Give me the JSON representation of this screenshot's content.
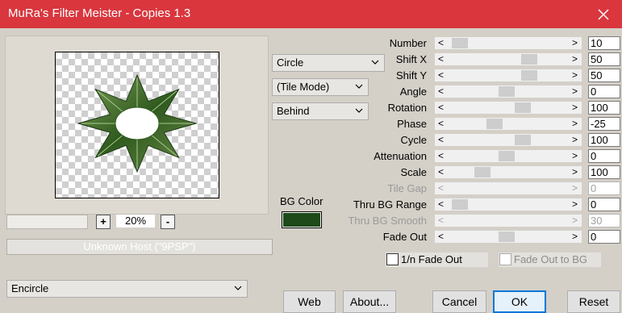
{
  "window": {
    "title": "MuRa's Filter Meister - Copies 1.3"
  },
  "preview": {
    "zoom": "20%",
    "zoom_in_label": "+",
    "zoom_out_label": "-",
    "host_text": "Unknown Host (\"9PSP\")"
  },
  "dropdowns": {
    "shape": "Circle",
    "tile_mode": "(Tile Mode)",
    "placement": "Behind",
    "preset": "Encircle"
  },
  "bg_color": {
    "label": "BG Color",
    "value": "#1e4a1a"
  },
  "params": [
    {
      "label": "Number",
      "value": "10"
    },
    {
      "label": "Shift X",
      "value": "50"
    },
    {
      "label": "Shift Y",
      "value": "50"
    },
    {
      "label": "Angle",
      "value": "0"
    },
    {
      "label": "Rotation",
      "value": "100"
    },
    {
      "label": "Phase",
      "value": "-25"
    },
    {
      "label": "Cycle",
      "value": "100"
    },
    {
      "label": "Attenuation",
      "value": "0"
    },
    {
      "label": "Scale",
      "value": "100"
    },
    {
      "label": "Tile Gap",
      "value": "0"
    },
    {
      "label": "Thru BG Range",
      "value": "0"
    },
    {
      "label": "Thru BG Smooth",
      "value": "30"
    },
    {
      "label": "Fade Out",
      "value": "0"
    }
  ],
  "checkboxes": {
    "inv_fade_out": "1/n Fade Out",
    "fade_out_bg": "Fade Out to BG"
  },
  "buttons": {
    "web": "Web",
    "about": "About...",
    "cancel": "Cancel",
    "ok": "OK",
    "reset": "Reset"
  },
  "colors": {
    "title_bar": "#d9363e",
    "dialog_bg": "#d4d0c8",
    "ok_border": "#0078d7"
  }
}
